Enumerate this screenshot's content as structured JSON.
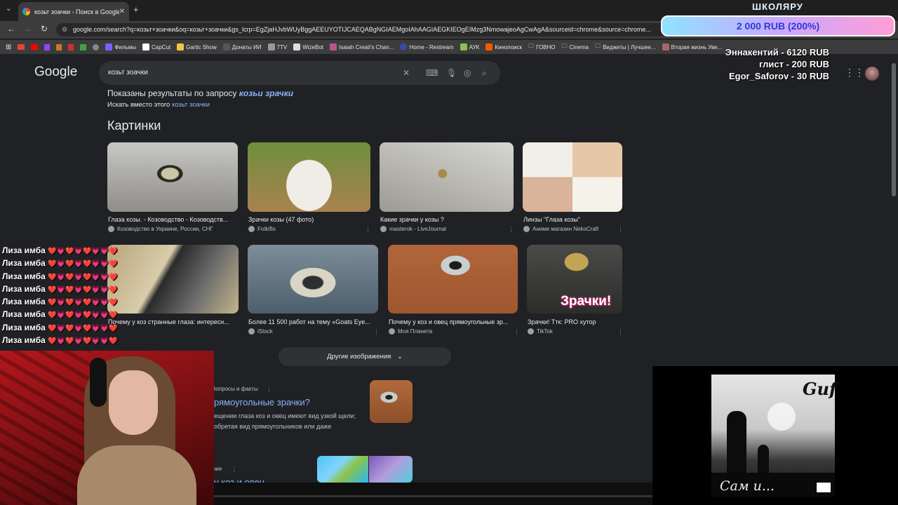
{
  "browser": {
    "tab_title": "козьт зоачки - Поиск в Google",
    "url": "google.com/search?q=козьт+зоачки&oq=козьт+зоачки&gs_lcrp=EgZjaHJvbWUyBggAEEUYOTIJCAEQABgNGIAEMgoIAhAAGIAEGKIEOgEIMzg3NmowajeoAgCwAgA&sourceid=chrome&source=chrome...",
    "bookmarks": [
      "Фильмы",
      "CapCut",
      "Gartic Show",
      "Донаты ИИ",
      "7TV",
      "WizeBot",
      "Isaiah Creati's Chan...",
      "Home - Restream",
      "АУК",
      "Кинопоиск",
      "ГОВНО",
      "Cinema",
      "Виджеты | Лучшее...",
      "Вторая жизнь Уве..."
    ]
  },
  "google": {
    "logo": "Google",
    "query": "козьт зоачки",
    "showing_results_prefix": "Показаны результаты по запросу",
    "corrected_query": "козьи зрачки",
    "search_instead_prefix": "Искать вместо этого",
    "original_query": "козьт зоачки",
    "images_heading": "Картинки",
    "images_row1": [
      {
        "caption": "Глаза козы. - Козоводство - Козоводств...",
        "source": "Козоводство в Украине, России, СНГ"
      },
      {
        "caption": "Зрачки козы (47 фото)",
        "source": "Fotkiflo"
      },
      {
        "caption": "Какие зрачки у козы ?",
        "source": "masterok - LiveJournal"
      },
      {
        "caption": "Линзы \"Глаза козы\"",
        "source": "Аниме магазин NekoCraft"
      }
    ],
    "images_row2": [
      {
        "caption": "Почему у коз странные глаза: интересн...",
        "source": ""
      },
      {
        "caption": "Более 11 500 работ на тему «Goats Eye...",
        "source": "iStock"
      },
      {
        "caption": "Почему у коз и овец прямоугольные зр...",
        "source": "Моя Планета"
      },
      {
        "caption": "Зрачки! Ттк: PRO хутор",
        "source": "TikTok"
      }
    ],
    "thumb_overlay_text": "Зрачки!",
    "more_images": "Другие изображения",
    "qa_label": "Вопросы и факты",
    "qa_title": "рямоугольные зрачки?",
    "qa_snippet_1": "ещении глаза коз и овец имеют вид узкой щели;",
    "qa_snippet_2": "обретая вид прямоугольников или даже",
    "section2_label": "ние",
    "section2_title": "у коз и овец"
  },
  "stream": {
    "donate_title": "ШКОЛЯРУ",
    "donate_progress": "2 000 RUB (200%)",
    "donors": [
      "Эннакентий - 6120 RUB",
      "глист - 200 RUB",
      "Egor_Saforov - 30 RUB"
    ],
    "chat_line": "Лиза имба",
    "chat_hearts": "❤️💗❤️💗❤️💗💗❤️",
    "album_artist": "Guf",
    "album_title": "Сам и..."
  }
}
